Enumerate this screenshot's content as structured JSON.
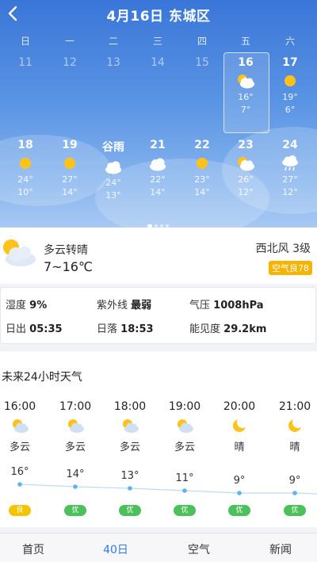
{
  "header": {
    "title": "4月16日 东城区"
  },
  "weekdays": [
    "日",
    "一",
    "二",
    "三",
    "四",
    "五",
    "六"
  ],
  "calendar": {
    "row1": [
      {
        "date": "11"
      },
      {
        "date": "12"
      },
      {
        "date": "13"
      },
      {
        "date": "14"
      },
      {
        "date": "15"
      },
      {
        "date": "16",
        "icon": "partly-cloudy-icon",
        "high": "16°",
        "low": "7°"
      },
      {
        "date": "17",
        "icon": "sunny-icon",
        "high": "19°",
        "low": "6°"
      }
    ],
    "row2": [
      {
        "date": "18",
        "icon": "sunny-icon",
        "high": "24°",
        "low": "10°"
      },
      {
        "date": "19",
        "icon": "sunny-icon",
        "high": "27°",
        "low": "14°"
      },
      {
        "date": "谷雨",
        "icon": "cloudy-icon",
        "high": "24°",
        "low": "13°"
      },
      {
        "date": "21",
        "icon": "cloudy-icon",
        "high": "22°",
        "low": "14°"
      },
      {
        "date": "22",
        "icon": "sunny-icon",
        "high": "23°",
        "low": "14°"
      },
      {
        "date": "23",
        "icon": "partly-cloudy-icon",
        "high": "26°",
        "low": "12°"
      },
      {
        "date": "24",
        "icon": "rain-icon",
        "high": "27°",
        "low": "12°"
      }
    ]
  },
  "summary": {
    "condition": "多云转晴",
    "range": "7~16℃",
    "wind": "西北风 3级",
    "aqi": "空气良78",
    "aqi_color": "#f5b400"
  },
  "details": {
    "humidity_label": "湿度",
    "humidity": "9%",
    "uv_label": "紫外线",
    "uv": "最弱",
    "pressure_label": "气压",
    "pressure": "1008hPa",
    "sunrise_label": "日出",
    "sunrise": "05:35",
    "sunset_label": "日落",
    "sunset": "18:53",
    "visibility_label": "能见度",
    "visibility": "29.2km"
  },
  "hourly": {
    "title": "未来24小时天气",
    "items": [
      {
        "time": "16:00",
        "icon": "partly-cloudy-icon",
        "cond": "多云",
        "temp": "16°",
        "aqi": "良",
        "aqi_color": "#f5c400"
      },
      {
        "time": "17:00",
        "icon": "partly-cloudy-icon",
        "cond": "多云",
        "temp": "14°",
        "aqi": "优",
        "aqi_color": "#4cc05a"
      },
      {
        "time": "18:00",
        "icon": "partly-cloudy-icon",
        "cond": "多云",
        "temp": "13°",
        "aqi": "优",
        "aqi_color": "#4cc05a"
      },
      {
        "time": "19:00",
        "icon": "partly-cloudy-icon",
        "cond": "多云",
        "temp": "11°",
        "aqi": "优",
        "aqi_color": "#4cc05a"
      },
      {
        "time": "20:00",
        "icon": "moon-icon",
        "cond": "晴",
        "temp": "9°",
        "aqi": "优",
        "aqi_color": "#4cc05a"
      },
      {
        "time": "21:00",
        "icon": "moon-icon",
        "cond": "晴",
        "temp": "9°",
        "aqi": "优",
        "aqi_color": "#4cc05a"
      }
    ]
  },
  "nav": [
    "首页",
    "40日",
    "空气",
    "新闻"
  ],
  "accent": "#2f7be7"
}
